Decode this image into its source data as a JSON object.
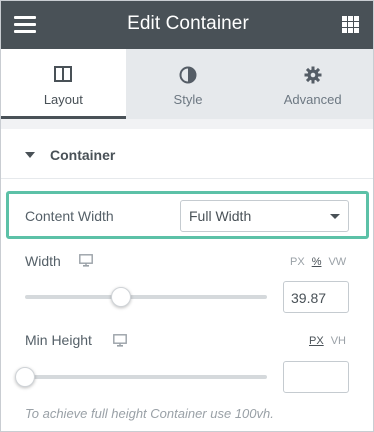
{
  "header": {
    "title": "Edit Container",
    "menu_icon": "hamburger-menu-icon",
    "apps_icon": "grid-apps-icon",
    "background": "#495157"
  },
  "tabs": [
    {
      "label": "Layout",
      "icon": "layout-columns-icon",
      "active": true
    },
    {
      "label": "Style",
      "icon": "contrast-circle-icon",
      "active": false
    },
    {
      "label": "Advanced",
      "icon": "gear-icon",
      "active": false
    }
  ],
  "section": {
    "title": "Container",
    "caret_icon": "caret-down-icon"
  },
  "content_width": {
    "label": "Content Width",
    "value": "Full Width",
    "highlight_color": "#5cc1a7"
  },
  "width": {
    "label": "Width",
    "device_icon": "desktop-monitor-icon",
    "units": [
      "PX",
      "%",
      "VW"
    ],
    "selected_unit": "%",
    "value": "39.87",
    "slider_fraction": 0.3987
  },
  "min_height": {
    "label": "Min Height",
    "device_icon": "desktop-monitor-icon",
    "units": [
      "PX",
      "VH"
    ],
    "selected_unit": "PX",
    "value": "",
    "slider_fraction": 0
  },
  "hint": "To achieve full height Container use 100vh."
}
